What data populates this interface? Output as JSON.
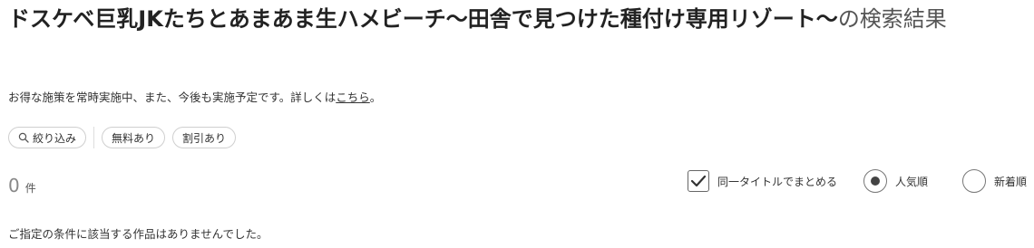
{
  "search": {
    "query": "ドスケベ巨乳JKたちとあまあま生ハメビーチ〜田舎で見つけた種付け専用リゾート〜",
    "title_suffix": "の検索結果"
  },
  "notice": {
    "text": "お得な施策を常時実施中、また、今後も実施予定です。詳しくは",
    "link_label": "こちら",
    "end": "。"
  },
  "filters": {
    "narrow_label": "絞り込み",
    "narrow_icon": "search-icon",
    "chips": [
      "無料あり",
      "割引あり"
    ]
  },
  "results": {
    "count": "0",
    "unit": "件",
    "empty_message": "ご指定の条件に該当する作品はありませんでした。"
  },
  "options": {
    "group_same_title": {
      "label": "同一タイトルでまとめる",
      "checked": true
    },
    "sort": {
      "popular_label": "人気順",
      "new_label": "新着順",
      "selected": "popular"
    }
  }
}
